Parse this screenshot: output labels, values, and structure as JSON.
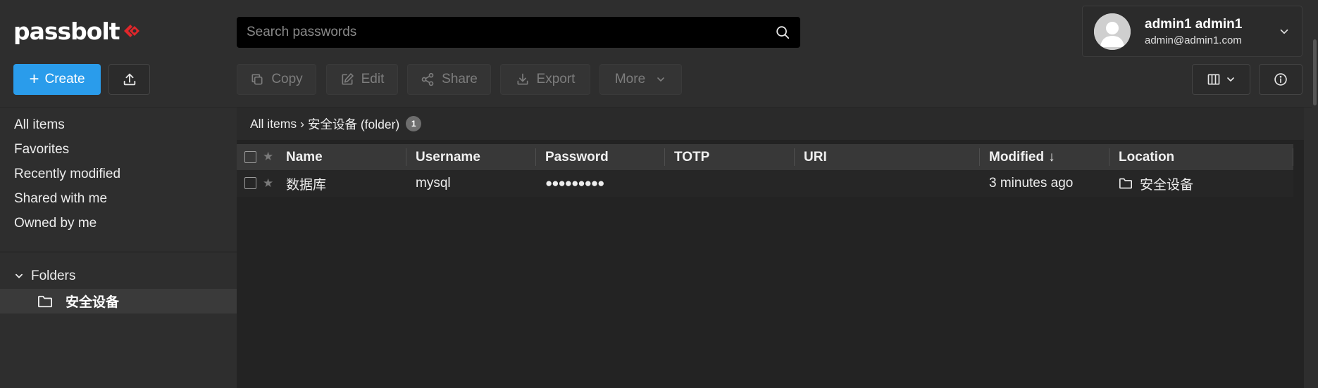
{
  "app": {
    "brand": "passbolt"
  },
  "search": {
    "placeholder": "Search passwords"
  },
  "user": {
    "name": "admin1 admin1",
    "email": "admin@admin1.com"
  },
  "toolbar": {
    "create_label": "Create",
    "copy_label": "Copy",
    "edit_label": "Edit",
    "share_label": "Share",
    "export_label": "Export",
    "more_label": "More"
  },
  "sidebar": {
    "items": [
      {
        "label": "All items"
      },
      {
        "label": "Favorites"
      },
      {
        "label": "Recently modified"
      },
      {
        "label": "Shared with me"
      },
      {
        "label": "Owned by me"
      }
    ],
    "folders_label": "Folders",
    "folders": [
      {
        "name": "安全设备"
      }
    ]
  },
  "breadcrumb": {
    "root": "All items",
    "separator": "›",
    "current": "安全设备 (folder)",
    "count": "1"
  },
  "grid": {
    "columns": [
      "Name",
      "Username",
      "Password",
      "TOTP",
      "URI",
      "Modified",
      "Location"
    ],
    "sort_indicator": "↓",
    "rows": [
      {
        "name": "数据库",
        "username": "mysql",
        "password": "●●●●●●●●●",
        "totp": "",
        "uri": "",
        "modified": "3 minutes ago",
        "location": "安全设备"
      }
    ]
  },
  "colors": {
    "accent": "#2a9ceb",
    "background": "#2e2e2e",
    "grid_background": "#232323",
    "logo_mark": "#e0262a"
  }
}
